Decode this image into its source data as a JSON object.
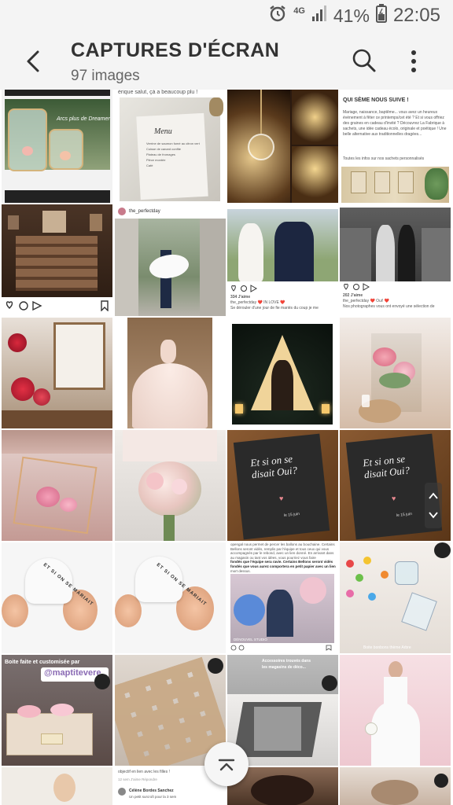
{
  "status_bar": {
    "network_label": "4G",
    "battery_percent": "41%",
    "time": "22:05"
  },
  "header": {
    "title": "CAPTURES D'ÉCRAN",
    "image_count": "97 images"
  },
  "thumbnails": {
    "t1": {
      "caption": "Arcs plus de Dreamer",
      "extra": ""
    },
    "t2": {
      "top": "érique salut, çà a beaucoup plu !",
      "heading": "Menu",
      "lines": [
        "Verrine de saumon fumé au citron vert",
        "et sa chantilly",
        "Cuisse de canard confite",
        "et ses légumes",
        "Plateau de fromages",
        "Pièce montée",
        "Café"
      ]
    },
    "t3": {
      "caption": ""
    },
    "t4": {
      "heading": "QUI SÈME NOUS SUIVE !",
      "body": "Mariage, naissance, baptême... vous avez un heureux événement à fêter ce printemps/cet été ? Et si vous offriez des graines en cadeau d'invité ? Découvrez La Fabrique à sachets, une idée cadeau écolo, originale et poétique ! Une belle alternative aux traditionnelles dragées...",
      "footer": "Toutes les infos sur nos sachets personnalisés"
    },
    "t6": {
      "username": "the_perfectday"
    },
    "t7": {
      "likes": "334 J'aime",
      "caption": "the_perfectday ❤️ IN LOVE ❤️",
      "sub": "Se dérouler d'une jour de fie mariés du coup je me"
    },
    "t8": {
      "likes": "202 J'aime",
      "caption": "the_perfectday ❤️ Oui! ❤️",
      "sub": "Nos photographes vous ont envoyé une sélection de"
    },
    "t15": {
      "script": "Et si on se disait Oui?",
      "sign": "le 15 juin"
    },
    "t16": {
      "script": "Et si on se disait Oui?",
      "sign": "le 15 juin"
    },
    "t17": {
      "ribbon": "ET SI ON SE MARIAIT"
    },
    "t18": {
      "ribbon": "ET SI ON SE MARIAIT"
    },
    "t19": {
      "top": "opengal nous permet de percer les ballons au bouchaine. Certains Bellons seront vidés, remplis par l'équipe et tous ceux qui vous accompagnés par le rebond, avec un lien donné. En arrivant dans au magasin ou tant vos idées, vous pourriez vous faire",
      "bold": "fondés que l'équipe sera ravie. Certains Bellons seront vidés fondés que vous aurez comportera en petit papier avec un lien",
      "tail": "mort dessus.",
      "label": "DÉNOUVEL STUDIO"
    },
    "t20": {
      "caption": "Boite bonbons thème Arbre"
    },
    "t21": {
      "line1": "Boite faite et customisée par",
      "tag": "@maptitevere"
    },
    "t23": {
      "caption": "Accessoires trouvés dans les magasins de déco..."
    },
    "t26": {
      "line1": "objectif en lien avec les filles !",
      "line2": "12 sem   J'aime   Répondre",
      "line3": "Célène Bordes Sanchez",
      "line4": "Un petit surcroît pour la 3 sem"
    }
  },
  "scroll_top_button": {
    "icon": "chevron-up"
  }
}
